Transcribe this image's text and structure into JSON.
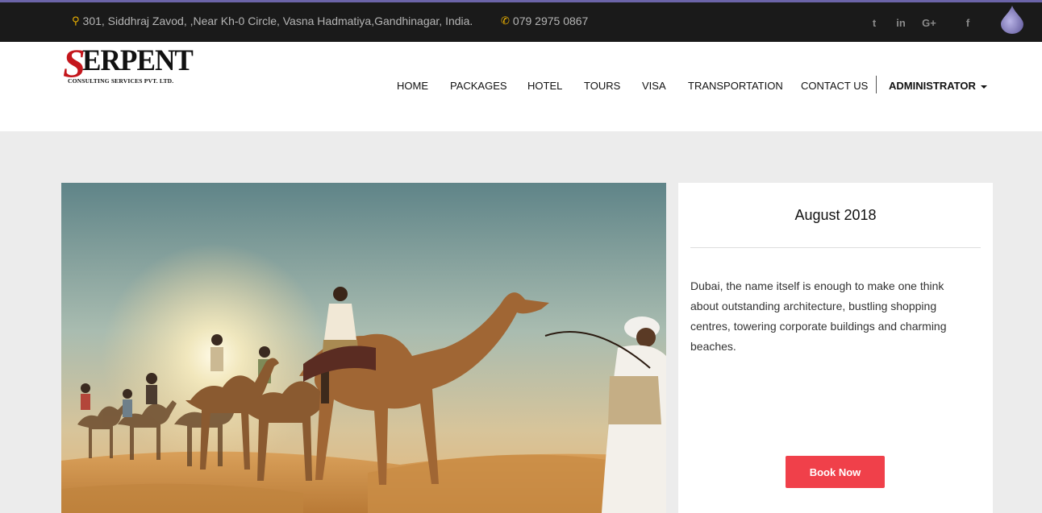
{
  "topbar": {
    "address": "301, Siddhraj Zavod, ,Near Kh-0 Circle, Vasna Hadmatiya,Gandhinagar, India.",
    "phone": "079 2975 0867",
    "social_icons": [
      "twitter-icon",
      "linkedin-icon",
      "google-plus-icon",
      "facebook-icon"
    ],
    "social_glyphs": {
      "twitter": "t",
      "linkedin": "in",
      "google_plus": "G+",
      "facebook": "f"
    },
    "accent_color": "#f0b400"
  },
  "logo": {
    "mark": "S",
    "word": "ERPENT",
    "subtitle": "CONSULTING SERVICES PVT. LTD."
  },
  "nav": {
    "items": [
      "HOME",
      "PACKAGES",
      "HOTEL",
      "TOURS",
      "VISA",
      "TRANSPORTATION",
      "CONTACT US"
    ],
    "admin": "ADMINISTRATOR"
  },
  "package": {
    "image": "desert camel caravan photo",
    "month": "August 2018",
    "description": "Dubai, the name itself is enough to make one think about outstanding architecture, bustling shopping centres, towering corporate buildings and charming beaches.",
    "button": "Book Now",
    "button_color": "#f0404a"
  }
}
